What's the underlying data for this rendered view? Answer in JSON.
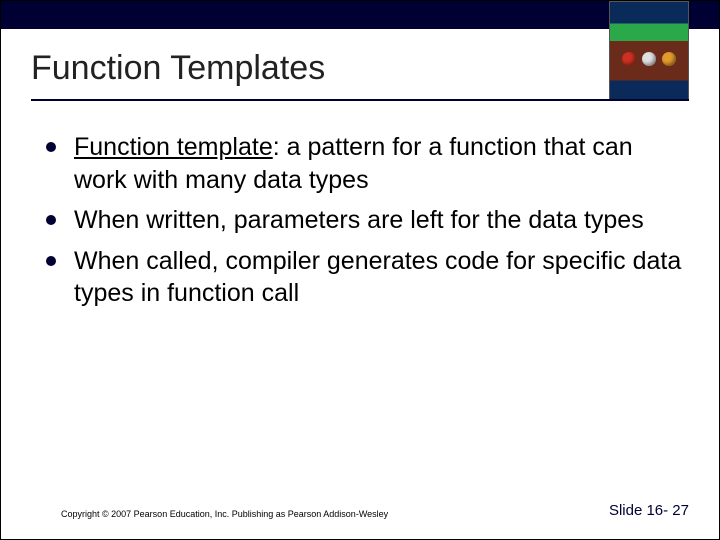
{
  "title": "Function Templates",
  "bullets": [
    {
      "term": "Function template",
      "rest": ": a pattern for a function that can work with many data types"
    },
    {
      "term": "",
      "rest": "When written, parameters are left for the data types"
    },
    {
      "term": "",
      "rest": "When called, compiler generates code for specific data types in function call"
    }
  ],
  "footer": {
    "copyright": "Copyright © 2007 Pearson Education, Inc. Publishing as Pearson Addison-Wesley",
    "slide_number": "Slide 16- 27"
  }
}
